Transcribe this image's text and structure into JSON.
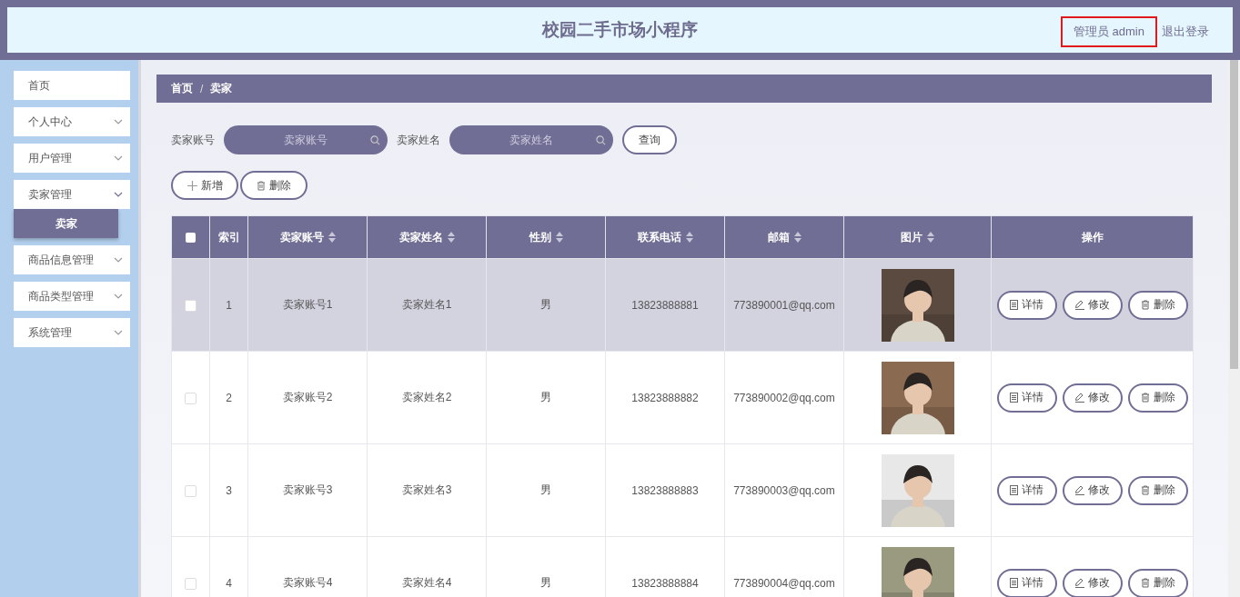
{
  "header": {
    "title": "校园二手市场小程序",
    "user": "管理员 admin",
    "logout": "退出登录"
  },
  "sidebar": {
    "items": [
      {
        "label": "首页"
      },
      {
        "label": "个人中心",
        "expanded": false
      },
      {
        "label": "用户管理",
        "expanded": false
      },
      {
        "label": "卖家管理",
        "expanded": true,
        "children": [
          {
            "label": "卖家",
            "selected": true
          }
        ]
      },
      {
        "label": "商品信息管理",
        "expanded": false
      },
      {
        "label": "商品类型管理",
        "expanded": false
      },
      {
        "label": "系统管理",
        "expanded": false
      }
    ]
  },
  "breadcrumb": {
    "items": [
      "首页",
      "卖家"
    ],
    "separator": "/"
  },
  "search": [
    {
      "label": "卖家账号",
      "placeholder": "卖家账号"
    },
    {
      "label": "卖家姓名",
      "placeholder": "卖家姓名"
    }
  ],
  "query_button": "查询",
  "toolbar": [
    {
      "kind": "add",
      "label": "新增"
    },
    {
      "kind": "delete",
      "label": "删除"
    }
  ],
  "table": {
    "select_all": {
      "checked": false
    },
    "columns": [
      {
        "kind": "plain",
        "label": "索引"
      },
      {
        "kind": "sort",
        "label": "卖家账号"
      },
      {
        "kind": "sort",
        "label": "卖家姓名"
      },
      {
        "kind": "sort",
        "label": "性别"
      },
      {
        "kind": "sort",
        "label": "联系电话"
      },
      {
        "kind": "sort",
        "label": "邮箱"
      },
      {
        "kind": "sort",
        "label": "图片"
      },
      {
        "kind": "plain",
        "label": "操作"
      }
    ],
    "rows": [
      {
        "selected": true,
        "checked": false,
        "cells": [
          "1",
          "卖家账号1",
          "卖家姓名1",
          "男",
          "13823888881",
          "773890001@qq.com"
        ],
        "actions": [
          {
            "kind": "detail",
            "label": "详情"
          },
          {
            "kind": "edit",
            "label": "修改"
          },
          {
            "kind": "delete",
            "label": "删除"
          }
        ]
      },
      {
        "selected": false,
        "checked": false,
        "cells": [
          "2",
          "卖家账号2",
          "卖家姓名2",
          "男",
          "13823888882",
          "773890002@qq.com"
        ],
        "actions": [
          {
            "kind": "detail",
            "label": "详情"
          },
          {
            "kind": "edit",
            "label": "修改"
          },
          {
            "kind": "delete",
            "label": "删除"
          }
        ]
      },
      {
        "selected": false,
        "checked": false,
        "cells": [
          "3",
          "卖家账号3",
          "卖家姓名3",
          "男",
          "13823888883",
          "773890003@qq.com"
        ],
        "actions": [
          {
            "kind": "detail",
            "label": "详情"
          },
          {
            "kind": "edit",
            "label": "修改"
          },
          {
            "kind": "delete",
            "label": "删除"
          }
        ]
      },
      {
        "selected": false,
        "checked": false,
        "cells": [
          "4",
          "卖家账号4",
          "卖家姓名4",
          "男",
          "13823888884",
          "773890004@qq.com"
        ],
        "actions": [
          {
            "kind": "detail",
            "label": "详情"
          },
          {
            "kind": "edit",
            "label": "修改"
          },
          {
            "kind": "delete",
            "label": "删除"
          }
        ]
      }
    ]
  }
}
